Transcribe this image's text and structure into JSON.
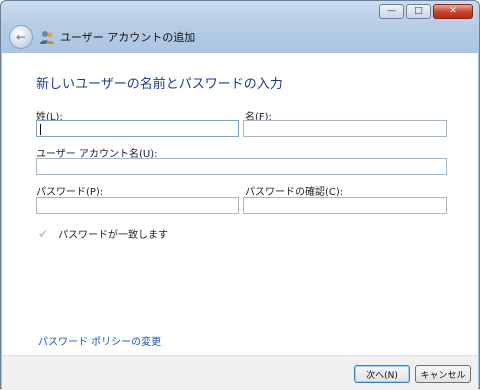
{
  "window": {
    "title": "ユーザー アカウントの追加",
    "icons": {
      "back": "back-arrow-icon",
      "app": "users-icon",
      "minimize": "minimize-icon",
      "maximize": "maximize-icon",
      "close": "close-icon"
    }
  },
  "form": {
    "heading": "新しいユーザーの名前とパスワードの入力",
    "last_name_label": "姓(L):",
    "last_name_value": "",
    "first_name_label": "名(F):",
    "first_name_value": "",
    "account_name_label": "ユーザー アカウント名(U):",
    "account_name_value": "",
    "password_label": "パスワード(P):",
    "password_value": "",
    "confirm_label": "パスワードの確認(C):",
    "confirm_value": "",
    "match_text": "パスワードが一致します",
    "match_icon": "checkmark-icon",
    "policy_link": "パスワード ポリシーの変更"
  },
  "footer": {
    "next_label": "次へ(N)",
    "cancel_label": "キャンセル"
  },
  "colors": {
    "heading": "#1f3a8a",
    "link": "#1a57b5",
    "close_button": "#c7412c"
  }
}
